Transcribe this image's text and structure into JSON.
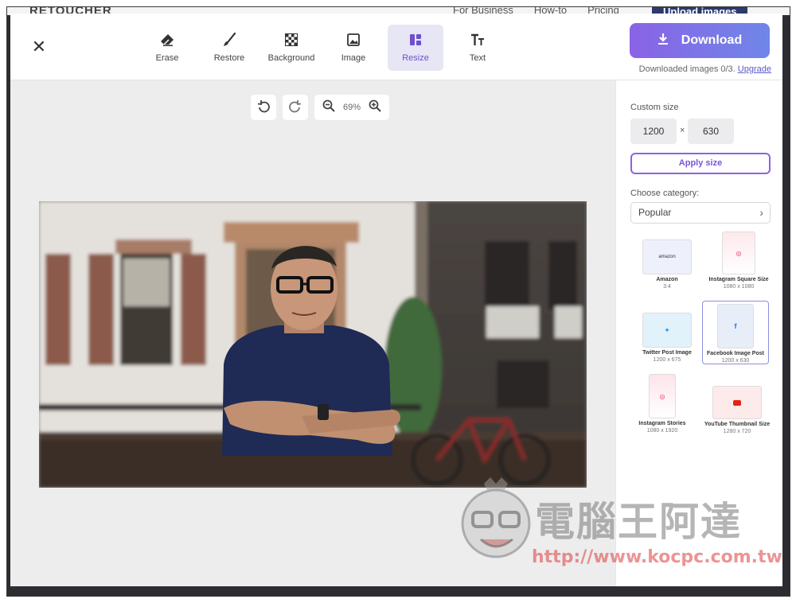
{
  "background_site": {
    "logo": "RETOUCHER",
    "links": [
      "For Business",
      "How-to",
      "Pricing"
    ],
    "upload_label": "Upload images"
  },
  "toolbar": {
    "close_icon": "close-icon",
    "tools": [
      {
        "label": "Erase",
        "icon": "eraser-icon"
      },
      {
        "label": "Restore",
        "icon": "brush-icon"
      },
      {
        "label": "Background",
        "icon": "checkerboard-icon"
      },
      {
        "label": "Image",
        "icon": "image-icon"
      },
      {
        "label": "Resize",
        "icon": "resize-icon",
        "active": true
      },
      {
        "label": "Text",
        "icon": "text-icon"
      }
    ],
    "download_label": "Download",
    "download_info": "Downloaded images 0/3.",
    "upgrade_label": "Upgrade",
    "accent": "#8a63e6"
  },
  "canvas": {
    "zoom": "69%"
  },
  "sidebar": {
    "custom_size_label": "Custom size",
    "width": "1200",
    "times": "×",
    "height": "630",
    "apply_label": "Apply size",
    "category_label": "Choose category:",
    "category_value": "Popular",
    "categories": [
      {
        "name": "Amazon",
        "dims": "3:4",
        "thumb_text": "amazon"
      },
      {
        "name": "Instagram Square Size",
        "dims": "1080 x 1080"
      },
      {
        "name": "Twitter Post Image",
        "dims": "1200 x 675"
      },
      {
        "name": "Facebook Image Post",
        "dims": "1200 x 630",
        "selected": true
      },
      {
        "name": "Instagram Stories",
        "dims": "1080 x 1920"
      },
      {
        "name": "YouTube Thumbnail Size",
        "dims": "1280 x 720"
      }
    ]
  },
  "watermark": {
    "title": "電腦王阿達",
    "url": "http://www.kocpc.com.tw"
  }
}
